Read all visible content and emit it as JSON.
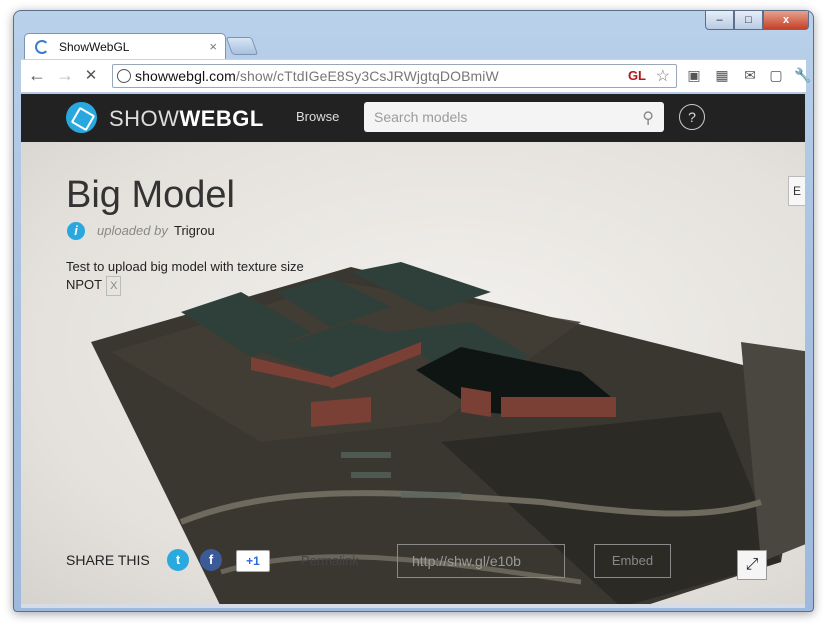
{
  "browser": {
    "tab_title": "ShowWebGL",
    "tab_close": "×",
    "window_buttons": {
      "minimize": "–",
      "maximize": "□",
      "close": "x"
    },
    "url_domain": "showwebgl.com",
    "url_path": "/show/cTtdIGeE8Sy3CsJRWjgtqDOBmiW",
    "gl_badge": "GL",
    "nav_back": "←",
    "nav_forward": "→",
    "nav_stop": "✕",
    "star": "☆",
    "extensions": [
      "▣",
      "▦",
      "✉",
      "▢",
      "🔧"
    ]
  },
  "site": {
    "logo_light": "SHOW",
    "logo_bold": "WEBGL",
    "browse": "Browse",
    "search_placeholder": "Search models",
    "help": "?"
  },
  "model": {
    "title": "Big Model",
    "uploaded_by_label": "uploaded by",
    "uploader": "Trigrou",
    "description": "Test to upload big model with texture size NPOT",
    "desc_close": "X",
    "side_button": "E"
  },
  "share": {
    "label": "SHARE THIS",
    "twitter": "t",
    "facebook": "f",
    "gplus": "+1",
    "permalink_label": "Permalink",
    "permalink_value": "http://shw.gl/e10b",
    "embed": "Embed",
    "fullscreen": "⤢"
  },
  "colors": {
    "accent": "#29a8e0",
    "navbar": "#222222",
    "scene_bg": "#e7e4df"
  }
}
